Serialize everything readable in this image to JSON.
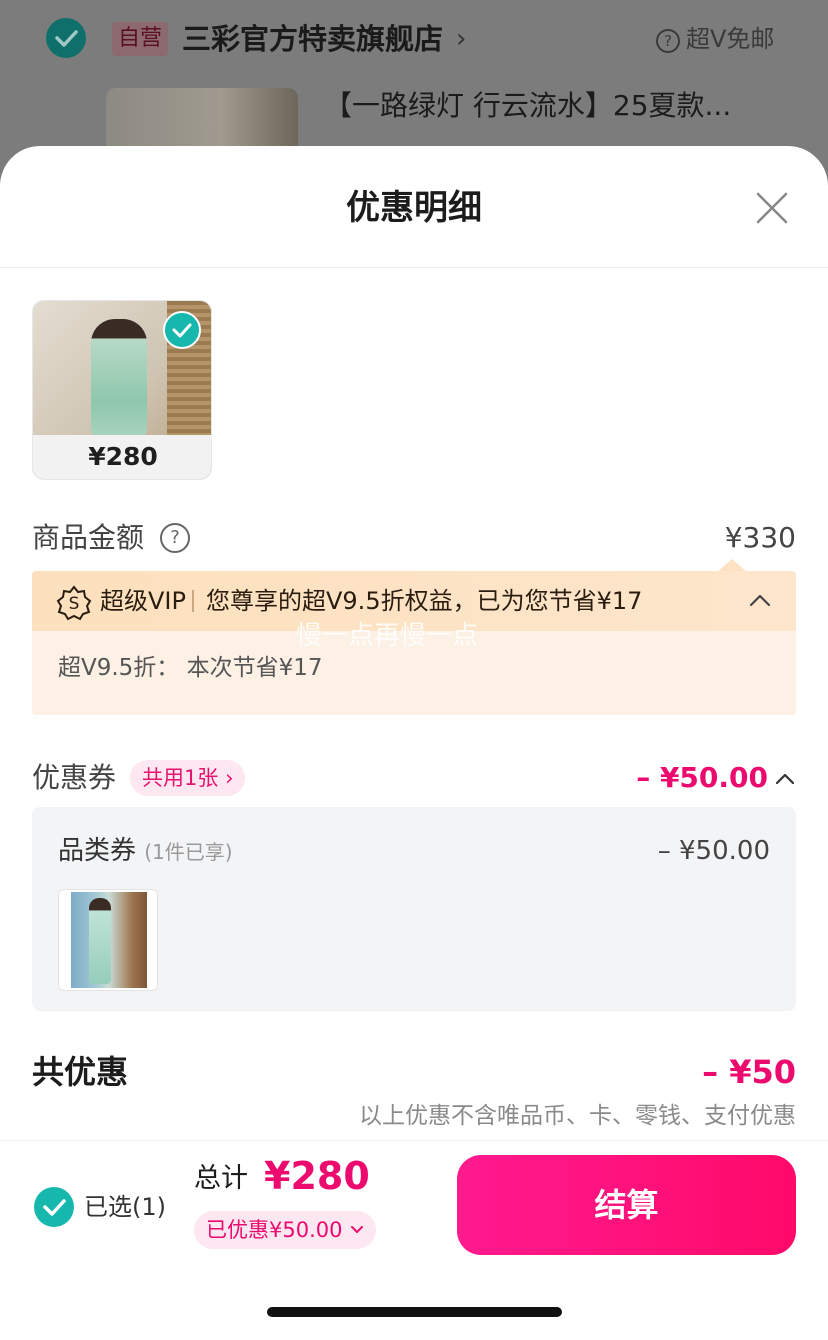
{
  "background": {
    "store_tag": "自营",
    "store_name": "三彩官方特卖旗舰店",
    "free_shipping": "超V免邮",
    "product_title": "【一路绿灯 行云流水】25夏款..."
  },
  "sheet": {
    "title": "优惠明细",
    "product_price": "¥280",
    "goods_amount_label": "商品金额",
    "goods_amount_value": "¥330",
    "vip_label": "超级VIP",
    "vip_text": "您尊享的超V9.5折权益，已为您节省¥17",
    "vip_detail": "超V9.5折：  本次节省¥17",
    "watermark": "慢一点再慢一点",
    "coupon_label": "优惠券",
    "coupon_pill": "共用1张",
    "coupon_value": "– ¥50.00",
    "category_coupon_label": "品类券",
    "category_coupon_sub": "(1件已享)",
    "category_coupon_value": "– ¥50.00",
    "total_discount_label": "共优惠",
    "total_discount_value": "– ¥50",
    "total_discount_note": "以上优惠不含唯品币、卡、零钱、支付优惠"
  },
  "footer": {
    "selected_label": "已选(1)",
    "total_label": "总计",
    "total_value": "¥280",
    "saved_pill": "已优惠¥50.00",
    "checkout_label": "结算"
  },
  "colors": {
    "accent_pink": "#ec0a6e",
    "teal": "#16b7ad",
    "vip_bg": "#fdf1e5"
  }
}
